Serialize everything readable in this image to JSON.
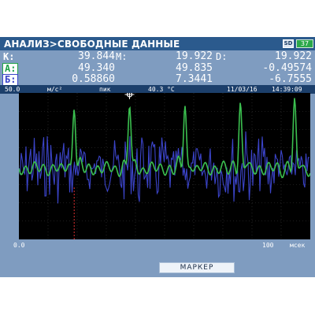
{
  "screen": {
    "title": "АНАЛИЗ>СВОБОДНЫЕ ДАННЫЕ",
    "battery": "37",
    "sd_icon": "SD"
  },
  "readouts": {
    "k_label": "К:",
    "m_label": "М:",
    "d_label": "D:",
    "k": "39.844",
    "m": "19.922",
    "d": "19.922",
    "a_label": "А:",
    "a1": "49.340",
    "a2": "49.835",
    "a3": "-0.49574",
    "b_label": "Б:",
    "b1": "0.58860",
    "b2": "7.3441",
    "b3": "-6.7555"
  },
  "info_bar": {
    "scale": "50.0",
    "unit": "м/с²",
    "mode": "пик",
    "temperature": "40.3 °C",
    "date": "11/03/16",
    "time": "14:39:09"
  },
  "axis": {
    "x_min": "0.0",
    "x_max": "100",
    "x_unit": "мсек"
  },
  "buttons": {
    "marker": "МАРКЕР"
  },
  "colors": {
    "header": "#2b5a8d",
    "panel": "#7f9cc0",
    "trace_a": "#3bbf4f",
    "trace_b": "#3b44c9",
    "cursor": "#e03030"
  },
  "chart_data": {
    "type": "line",
    "xlim": [
      0,
      100
    ],
    "x_unit": "мсек",
    "ymax_label": "50.0",
    "series": [
      {
        "trace": "А",
        "color": "#3bbf4f",
        "peak_positions_ms": [
          19.6,
          39.8,
          60.0,
          80.2,
          100.0
        ]
      },
      {
        "trace": "Б",
        "color": "#3b44c9",
        "style": "noisy broadband"
      }
    ],
    "markers": {
      "cursor_ms": 19.6,
      "marker_ms": 39.8
    }
  }
}
